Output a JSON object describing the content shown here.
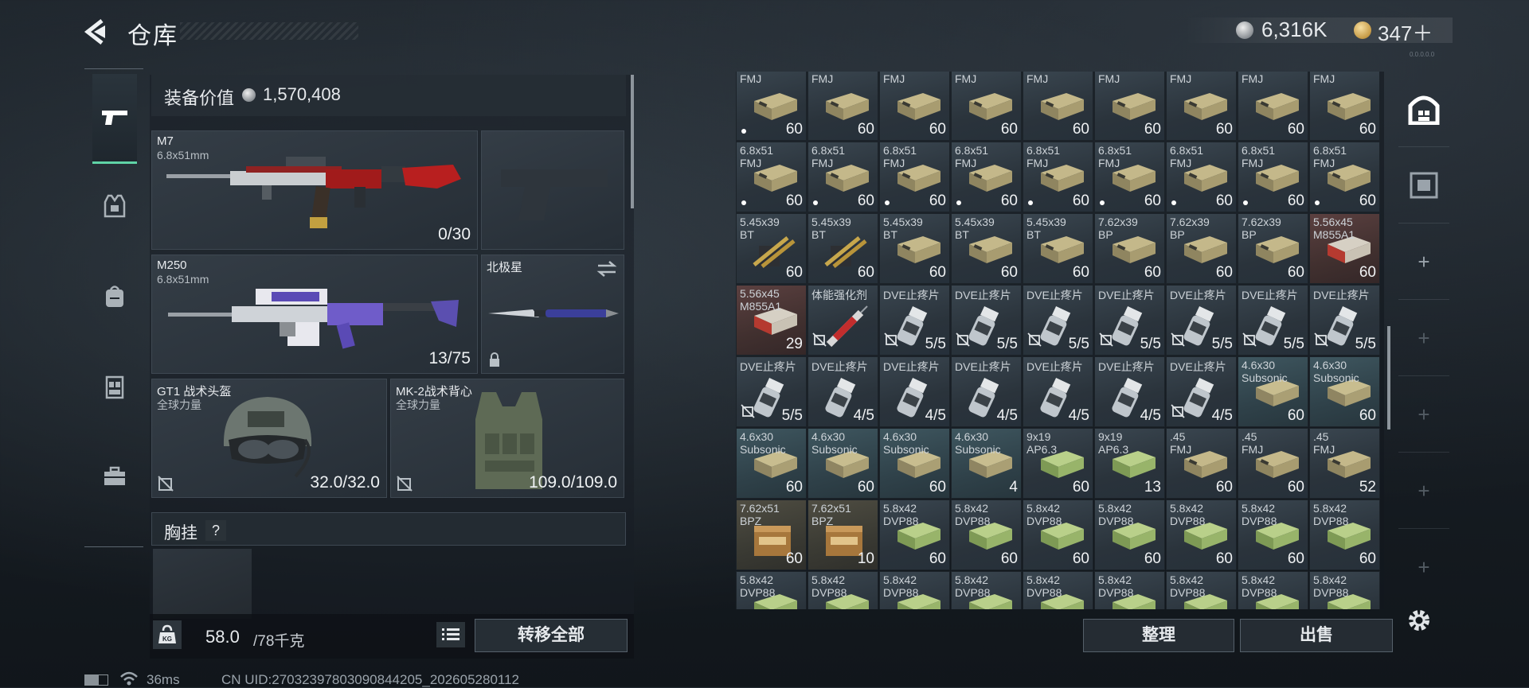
{
  "header": {
    "title": "仓库",
    "silver": "6,316K",
    "gold": "347＋",
    "version": "0.0.0.0.0"
  },
  "left_tabs": [
    "weapons",
    "armor",
    "backpack",
    "vest",
    "toolbox"
  ],
  "equipment": {
    "value_label": "装备价值",
    "value": "1,570,408",
    "slots": {
      "primary": {
        "name": "M7",
        "caliber": "6.8x51mm",
        "ammo": "0/30"
      },
      "secondary": {
        "name": "M250",
        "caliber": "6.8x51mm",
        "ammo": "13/75"
      },
      "melee": {
        "name": "北极星"
      },
      "helmet": {
        "name": "GT1 战术头盔",
        "tag": "全球力量",
        "durability": "32.0/32.0"
      },
      "armor": {
        "name": "MK-2战术背心",
        "tag": "全球力量",
        "durability": "109.0/109.0"
      }
    },
    "chest_label": "胸挂",
    "chest_help": "?",
    "weight": "58.0",
    "weight_max": "/78千克",
    "weight_icon_label": "KG",
    "transfer_all": "转移全部"
  },
  "inventory": {
    "cells": [
      {
        "l1": "FMJ",
        "l2": "",
        "q": "60",
        "kind": "box",
        "mark": "dot"
      },
      {
        "l1": "FMJ",
        "l2": "",
        "q": "60",
        "kind": "box",
        "mark": "none"
      },
      {
        "l1": "FMJ",
        "l2": "",
        "q": "60",
        "kind": "box",
        "mark": "none"
      },
      {
        "l1": "FMJ",
        "l2": "",
        "q": "60",
        "kind": "box",
        "mark": "none"
      },
      {
        "l1": "FMJ",
        "l2": "",
        "q": "60",
        "kind": "box",
        "mark": "none"
      },
      {
        "l1": "FMJ",
        "l2": "",
        "q": "60",
        "kind": "box",
        "mark": "none"
      },
      {
        "l1": "FMJ",
        "l2": "",
        "q": "60",
        "kind": "box",
        "mark": "none"
      },
      {
        "l1": "FMJ",
        "l2": "",
        "q": "60",
        "kind": "box",
        "mark": "none"
      },
      {
        "l1": "FMJ",
        "l2": "",
        "q": "60",
        "kind": "box",
        "mark": "none"
      },
      {
        "l1": "6.8x51",
        "l2": "FMJ",
        "q": "60",
        "kind": "box",
        "mark": "dot"
      },
      {
        "l1": "6.8x51",
        "l2": "FMJ",
        "q": "60",
        "kind": "box",
        "mark": "dot"
      },
      {
        "l1": "6.8x51",
        "l2": "FMJ",
        "q": "60",
        "kind": "box",
        "mark": "dot"
      },
      {
        "l1": "6.8x51",
        "l2": "FMJ",
        "q": "60",
        "kind": "box",
        "mark": "dot"
      },
      {
        "l1": "6.8x51",
        "l2": "FMJ",
        "q": "60",
        "kind": "box",
        "mark": "dot"
      },
      {
        "l1": "6.8x51",
        "l2": "FMJ",
        "q": "60",
        "kind": "box",
        "mark": "dot"
      },
      {
        "l1": "6.8x51",
        "l2": "FMJ",
        "q": "60",
        "kind": "box",
        "mark": "dot"
      },
      {
        "l1": "6.8x51",
        "l2": "FMJ",
        "q": "60",
        "kind": "box",
        "mark": "dot"
      },
      {
        "l1": "6.8x51",
        "l2": "FMJ",
        "q": "60",
        "kind": "box",
        "mark": "dot"
      },
      {
        "l1": "5.45x39",
        "l2": "BT",
        "q": "60",
        "kind": "rounds",
        "mark": "none"
      },
      {
        "l1": "5.45x39",
        "l2": "BT",
        "q": "60",
        "kind": "rounds",
        "mark": "none"
      },
      {
        "l1": "5.45x39",
        "l2": "BT",
        "q": "60",
        "kind": "box",
        "mark": "none"
      },
      {
        "l1": "5.45x39",
        "l2": "BT",
        "q": "60",
        "kind": "box",
        "mark": "none"
      },
      {
        "l1": "5.45x39",
        "l2": "BT",
        "q": "60",
        "kind": "box",
        "mark": "none"
      },
      {
        "l1": "7.62x39",
        "l2": "BP",
        "q": "60",
        "kind": "box",
        "mark": "none"
      },
      {
        "l1": "7.62x39",
        "l2": "BP",
        "q": "60",
        "kind": "box",
        "mark": "none"
      },
      {
        "l1": "7.62x39",
        "l2": "BP",
        "q": "60",
        "kind": "box",
        "mark": "none"
      },
      {
        "l1": "5.56x45",
        "l2": "M855A1",
        "q": "60",
        "kind": "redbox",
        "mark": "none"
      },
      {
        "l1": "5.56x45",
        "l2": "M855A1",
        "q": "29",
        "kind": "redbox",
        "mark": "none"
      },
      {
        "l1": "体能强化剂",
        "l2": "",
        "q": "",
        "kind": "syringe",
        "mark": "lock"
      },
      {
        "l1": "DVE止疼片",
        "l2": "",
        "q": "5/5",
        "kind": "pills",
        "mark": "lock"
      },
      {
        "l1": "DVE止疼片",
        "l2": "",
        "q": "5/5",
        "kind": "pills",
        "mark": "lock"
      },
      {
        "l1": "DVE止疼片",
        "l2": "",
        "q": "5/5",
        "kind": "pills",
        "mark": "lock"
      },
      {
        "l1": "DVE止疼片",
        "l2": "",
        "q": "5/5",
        "kind": "pills",
        "mark": "lock"
      },
      {
        "l1": "DVE止疼片",
        "l2": "",
        "q": "5/5",
        "kind": "pills",
        "mark": "lock"
      },
      {
        "l1": "DVE止疼片",
        "l2": "",
        "q": "5/5",
        "kind": "pills",
        "mark": "lock"
      },
      {
        "l1": "DVE止疼片",
        "l2": "",
        "q": "5/5",
        "kind": "pills",
        "mark": "lock"
      },
      {
        "l1": "DVE止疼片",
        "l2": "",
        "q": "5/5",
        "kind": "pills",
        "mark": "lock"
      },
      {
        "l1": "DVE止疼片",
        "l2": "",
        "q": "4/5",
        "kind": "pills",
        "mark": "none"
      },
      {
        "l1": "DVE止疼片",
        "l2": "",
        "q": "4/5",
        "kind": "pills",
        "mark": "none"
      },
      {
        "l1": "DVE止疼片",
        "l2": "",
        "q": "4/5",
        "kind": "pills",
        "mark": "none"
      },
      {
        "l1": "DVE止疼片",
        "l2": "",
        "q": "4/5",
        "kind": "pills",
        "mark": "none"
      },
      {
        "l1": "DVE止疼片",
        "l2": "",
        "q": "4/5",
        "kind": "pills",
        "mark": "none"
      },
      {
        "l1": "DVE止疼片",
        "l2": "",
        "q": "4/5",
        "kind": "pills",
        "mark": "lock"
      },
      {
        "l1": "4.6x30",
        "l2": "Subsonic",
        "q": "60",
        "kind": "tealbox",
        "mark": "none"
      },
      {
        "l1": "4.6x30",
        "l2": "Subsonic",
        "q": "60",
        "kind": "tealbox",
        "mark": "none"
      },
      {
        "l1": "4.6x30",
        "l2": "Subsonic",
        "q": "60",
        "kind": "tealbox",
        "mark": "none"
      },
      {
        "l1": "4.6x30",
        "l2": "Subsonic",
        "q": "60",
        "kind": "tealbox",
        "mark": "none"
      },
      {
        "l1": "4.6x30",
        "l2": "Subsonic",
        "q": "60",
        "kind": "tealbox",
        "mark": "none"
      },
      {
        "l1": "4.6x30",
        "l2": "Subsonic",
        "q": "4",
        "kind": "tealbox",
        "mark": "none"
      },
      {
        "l1": "9x19",
        "l2": "AP6.3",
        "q": "60",
        "kind": "greenbox",
        "mark": "none"
      },
      {
        "l1": "9x19",
        "l2": "AP6.3",
        "q": "13",
        "kind": "greenbox",
        "mark": "none"
      },
      {
        "l1": ".45",
        "l2": "FMJ",
        "q": "60",
        "kind": "box",
        "mark": "none"
      },
      {
        "l1": ".45",
        "l2": "FMJ",
        "q": "60",
        "kind": "box",
        "mark": "none"
      },
      {
        "l1": ".45",
        "l2": "FMJ",
        "q": "52",
        "kind": "box",
        "mark": "none"
      },
      {
        "l1": "7.62x51",
        "l2": "BPZ",
        "q": "60",
        "kind": "crate",
        "mark": "none"
      },
      {
        "l1": "7.62x51",
        "l2": "BPZ",
        "q": "10",
        "kind": "crate",
        "mark": "none"
      },
      {
        "l1": "5.8x42",
        "l2": "DVP88",
        "q": "60",
        "kind": "greenbox",
        "mark": "none"
      },
      {
        "l1": "5.8x42",
        "l2": "DVP88",
        "q": "60",
        "kind": "greenbox",
        "mark": "none"
      },
      {
        "l1": "5.8x42",
        "l2": "DVP88",
        "q": "60",
        "kind": "greenbox",
        "mark": "none"
      },
      {
        "l1": "5.8x42",
        "l2": "DVP88",
        "q": "60",
        "kind": "greenbox",
        "mark": "none"
      },
      {
        "l1": "5.8x42",
        "l2": "DVP88",
        "q": "60",
        "kind": "greenbox",
        "mark": "none"
      },
      {
        "l1": "5.8x42",
        "l2": "DVP88",
        "q": "60",
        "kind": "greenbox",
        "mark": "none"
      },
      {
        "l1": "5.8x42",
        "l2": "DVP88",
        "q": "60",
        "kind": "greenbox",
        "mark": "none"
      },
      {
        "l1": "5.8x42",
        "l2": "DVP88",
        "q": "",
        "kind": "greenbox",
        "mark": "none"
      },
      {
        "l1": "5.8x42",
        "l2": "DVP88",
        "q": "",
        "kind": "greenbox",
        "mark": "none"
      },
      {
        "l1": "5.8x42",
        "l2": "DVP88",
        "q": "",
        "kind": "greenbox",
        "mark": "none"
      },
      {
        "l1": "5.8x42",
        "l2": "DVP88",
        "q": "",
        "kind": "greenbox",
        "mark": "none"
      },
      {
        "l1": "5.8x42",
        "l2": "DVP88",
        "q": "",
        "kind": "greenbox",
        "mark": "none"
      },
      {
        "l1": "5.8x42",
        "l2": "DVP88",
        "q": "",
        "kind": "greenbox",
        "mark": "none"
      },
      {
        "l1": "5.8x42",
        "l2": "DVP88",
        "q": "",
        "kind": "greenbox",
        "mark": "none"
      },
      {
        "l1": "5.8x42",
        "l2": "DVP88",
        "q": "",
        "kind": "greenbox",
        "mark": "none"
      },
      {
        "l1": "5.8x42",
        "l2": "DVP88",
        "q": "",
        "kind": "greenbox",
        "mark": "none"
      }
    ],
    "sort": "整理",
    "sell": "出售"
  },
  "right_tabs": [
    "stash-icon",
    "collection-icon",
    "add-tab",
    "add-tab",
    "add-tab",
    "add-tab",
    "add-tab"
  ],
  "status": {
    "ping": "36ms",
    "uid": "CN UID:27032397803090844205_202605280112"
  }
}
